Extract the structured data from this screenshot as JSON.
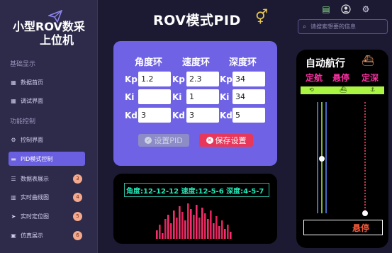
{
  "app": {
    "title_line1": "小型ROV数采",
    "title_line2": "上位机"
  },
  "sidebar": {
    "section_basic": "基础显示",
    "section_func": "功能控制",
    "items": [
      {
        "label": "数据首页",
        "icon": "table-icon"
      },
      {
        "label": "调试界面",
        "icon": "table-icon"
      },
      {
        "label": "控制界面",
        "icon": "gears-icon"
      },
      {
        "label": "PID模式控制",
        "icon": "folder-icon"
      },
      {
        "label": "数据表展示",
        "icon": "list-icon",
        "badge": "3"
      },
      {
        "label": "实时曲线图",
        "icon": "chart-icon",
        "badge": "4"
      },
      {
        "label": "实时定位图",
        "icon": "location-icon",
        "badge": "5"
      },
      {
        "label": "仿真展示",
        "icon": "sim-icon",
        "badge": "6"
      }
    ]
  },
  "header": {
    "title": "ROV模式PID",
    "title_symbol": "⚥"
  },
  "search": {
    "placeholder": "请搜索想要的信息"
  },
  "pid": {
    "columns": [
      "角度环",
      "速度环",
      "深度环"
    ],
    "rows": [
      "Kp",
      "Ki",
      "Kd"
    ],
    "values": {
      "angle": {
        "kp": "1.2",
        "ki": "",
        "kd": "3"
      },
      "speed": {
        "kp": "2.3",
        "ki": "1",
        "kd": "3"
      },
      "depth": {
        "kp": "34",
        "ki": "34",
        "kd": "5"
      }
    },
    "set_button": "设置PID",
    "save_button": "保存设置"
  },
  "readout": {
    "text": "角度:12-12-12 速度:12-5-6 深度:4-5-7"
  },
  "autonav": {
    "title": "自动航行",
    "modes": [
      "定航",
      "悬停",
      "定深"
    ],
    "status": "悬停"
  },
  "colors": {
    "accent": "#6f62e5",
    "active_nav": "#6a5fe0",
    "save_red": "#e8375a",
    "mode_pink": "#ff2fa3",
    "mode_bar": "#a9f541"
  }
}
